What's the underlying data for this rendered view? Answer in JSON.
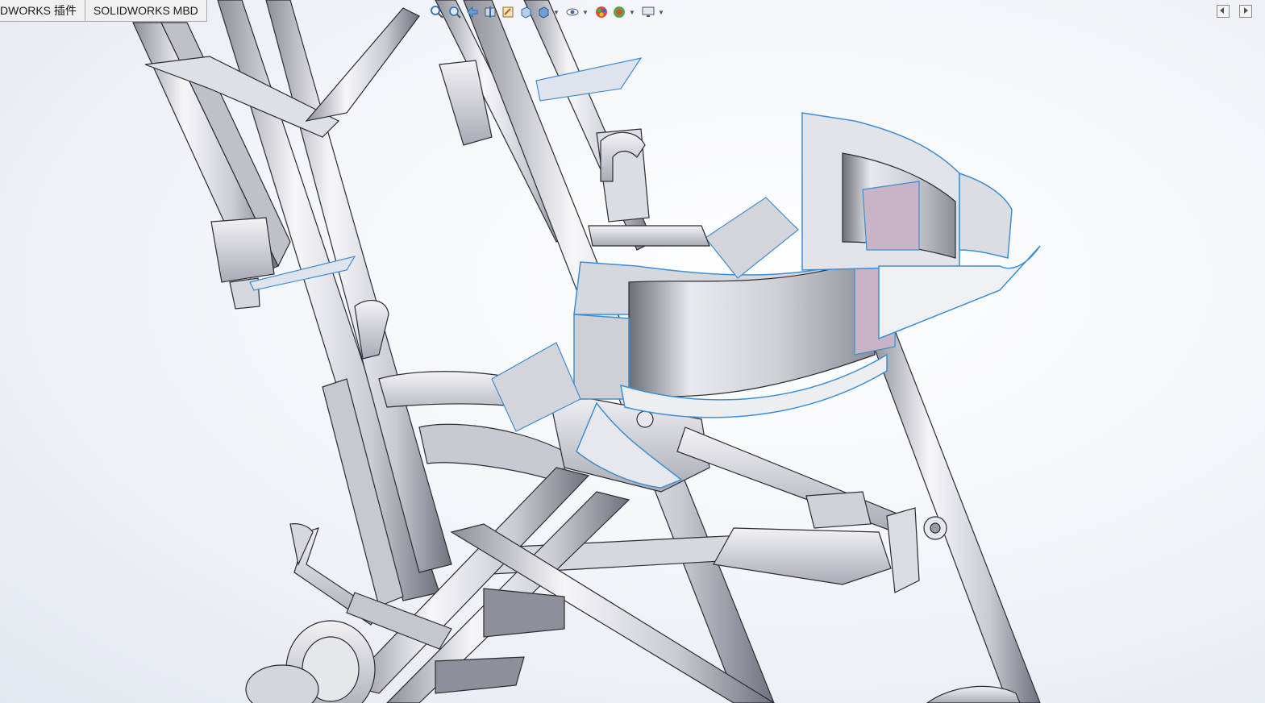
{
  "tabs": [
    {
      "label": "DWORKS 插件"
    },
    {
      "label": "SOLIDWORKS MBD"
    }
  ],
  "heads_up_toolbar": [
    {
      "icon": "zoom-to-fit-icon",
      "has_menu": false
    },
    {
      "icon": "zoom-to-area-icon",
      "has_menu": false
    },
    {
      "icon": "previous-view-icon",
      "has_menu": false
    },
    {
      "icon": "section-view-icon",
      "has_menu": false
    },
    {
      "icon": "dynamic-annotation-views-icon",
      "has_menu": false
    },
    {
      "icon": "view-orientation-icon",
      "has_menu": false
    },
    {
      "icon": "display-style-icon",
      "has_menu": true
    },
    {
      "icon": "hide-show-items-icon",
      "has_menu": true
    },
    {
      "icon": "edit-appearance-icon",
      "has_menu": false
    },
    {
      "icon": "apply-scene-icon",
      "has_menu": true
    },
    {
      "icon": "view-settings-icon",
      "has_menu": true
    }
  ],
  "view_controls": [
    {
      "icon": "collapse-left-icon"
    },
    {
      "icon": "collapse-right-icon"
    }
  ],
  "colors": {
    "accent_surface_edge": "#3b8fd4",
    "frame_fill": "#d9dbe2",
    "frame_edge": "#2b2b33",
    "surface_pink": "#c9b3c7",
    "surface_gray": "#d7d8de"
  }
}
